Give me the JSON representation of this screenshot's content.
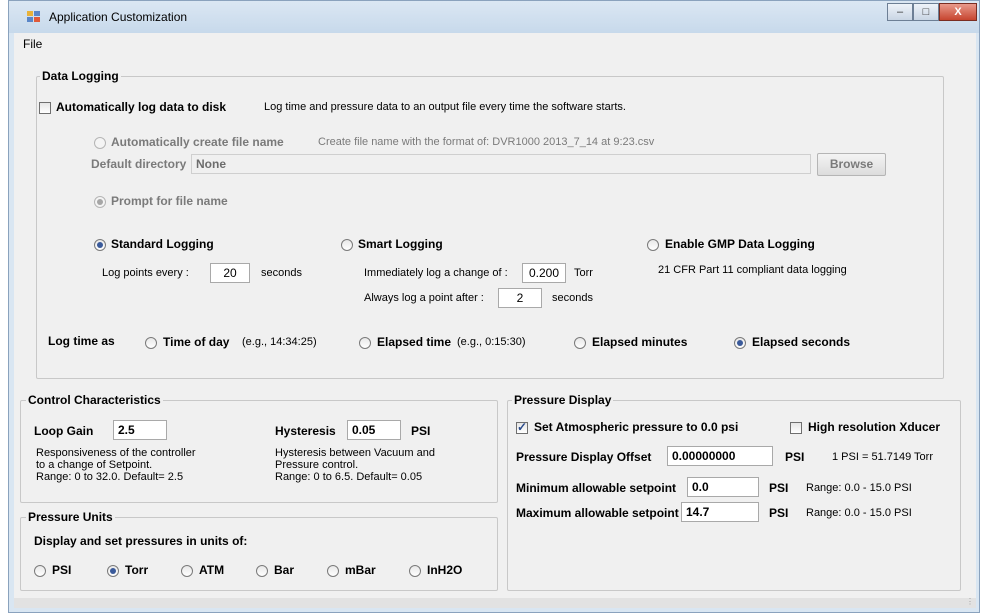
{
  "window": {
    "title": "Application Customization",
    "controls": {
      "minimize": "–",
      "maximize": "□",
      "close": "X"
    }
  },
  "menu": {
    "file": "File"
  },
  "data_logging": {
    "title": "Data Logging",
    "auto_log_label": "Automatically log data to disk",
    "auto_log_checked": false,
    "auto_log_desc": "Log time and pressure data to an output file every time the software starts.",
    "auto_create_label": "Automatically create file name",
    "auto_create_desc": "Create file name with the format of: DVR1000 2013_7_14 at 9:23.csv",
    "default_dir_label": "Default directory",
    "default_dir_value": "None",
    "browse_label": "Browse",
    "prompt_label": "Prompt for file name",
    "standard_label": "Standard Logging",
    "log_points_label": "Log points every :",
    "log_points_value": "20",
    "seconds_label": "seconds",
    "smart_label": "Smart Logging",
    "immediately_label": "Immediately log a change of :",
    "immediately_value": "0.200",
    "torr_label": "Torr",
    "always_label": "Always log a point after :",
    "always_value": "2",
    "seconds_label2": "seconds",
    "gmp_label": "Enable GMP Data Logging",
    "gmp_desc": "21 CFR Part 11 compliant data logging",
    "log_time_as": "Log time as",
    "time_of_day": "Time of day",
    "time_of_day_eg": "(e.g., 14:34:25)",
    "elapsed_time": "Elapsed time",
    "elapsed_time_eg": "(e.g., 0:15:30)",
    "elapsed_minutes": "Elapsed minutes",
    "elapsed_seconds": "Elapsed seconds",
    "selected_log_time": "elapsed_seconds"
  },
  "control": {
    "title": "Control Characteristics",
    "loop_gain_label": "Loop Gain",
    "loop_gain_value": "2.5",
    "loop_gain_desc1": "Responsiveness of the controller",
    "loop_gain_desc2": "to a change of Setpoint.",
    "loop_gain_desc3": "Range: 0 to 32.0.  Default= 2.5",
    "hysteresis_label": "Hysteresis",
    "hysteresis_value": "0.05",
    "hysteresis_unit": "PSI",
    "hysteresis_desc1": "Hysteresis between Vacuum and",
    "hysteresis_desc2": "Pressure control.",
    "hysteresis_desc3": "Range: 0 to 6.5.  Default= 0.05"
  },
  "units": {
    "title": "Pressure Units",
    "prompt": "Display and set pressures in units of:",
    "options": [
      "PSI",
      "Torr",
      "ATM",
      "Bar",
      "mBar",
      "InH2O"
    ],
    "selected": "Torr"
  },
  "display": {
    "title": "Pressure Display",
    "set_atm_label": "Set Atmospheric pressure to 0.0 psi",
    "set_atm_checked": true,
    "high_res_label": "High resolution Xducer",
    "high_res_checked": false,
    "offset_label": "Pressure Display Offset",
    "offset_value": "0.00000000",
    "offset_unit": "PSI",
    "conversion": "1 PSI = 51.7149 Torr",
    "min_label": "Minimum allowable setpoint",
    "min_value": "0.0",
    "min_unit": "PSI",
    "min_range": "Range: 0.0 - 15.0 PSI",
    "max_label": "Maximum allowable setpoint",
    "max_value": "14.7",
    "max_unit": "PSI",
    "max_range": "Range: 0.0 - 15.0 PSI"
  }
}
